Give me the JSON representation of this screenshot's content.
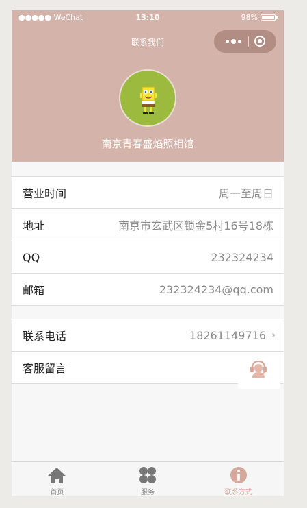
{
  "status_bar": {
    "carrier": "●●●●● WeChat",
    "time": "13:10",
    "battery": "98%"
  },
  "nav": {
    "title": "联系我们"
  },
  "profile": {
    "name": "南京青春盛焰照相馆",
    "avatar_icon": "spongebob-avatar"
  },
  "info": [
    {
      "label": "营业时间",
      "value": "周一至周日"
    },
    {
      "label": "地址",
      "value": "南京市玄武区锁金5村16号18栋"
    },
    {
      "label": "QQ",
      "value": "232324234"
    },
    {
      "label": "邮箱",
      "value": "232324234@qq.com"
    }
  ],
  "contact": {
    "phone_label": "联系电话",
    "phone_value": "18261149716",
    "service_label": "客服留言",
    "service_icon": "customer-service-icon"
  },
  "tabs": [
    {
      "label": "首页",
      "icon": "home-icon"
    },
    {
      "label": "服务",
      "icon": "grid-icon"
    },
    {
      "label": "联系方式",
      "icon": "info-icon",
      "active": true
    }
  ],
  "colors": {
    "header": "#d4b4aa",
    "accent": "#d4a89b",
    "avatar_bg": "#9cba3d"
  }
}
